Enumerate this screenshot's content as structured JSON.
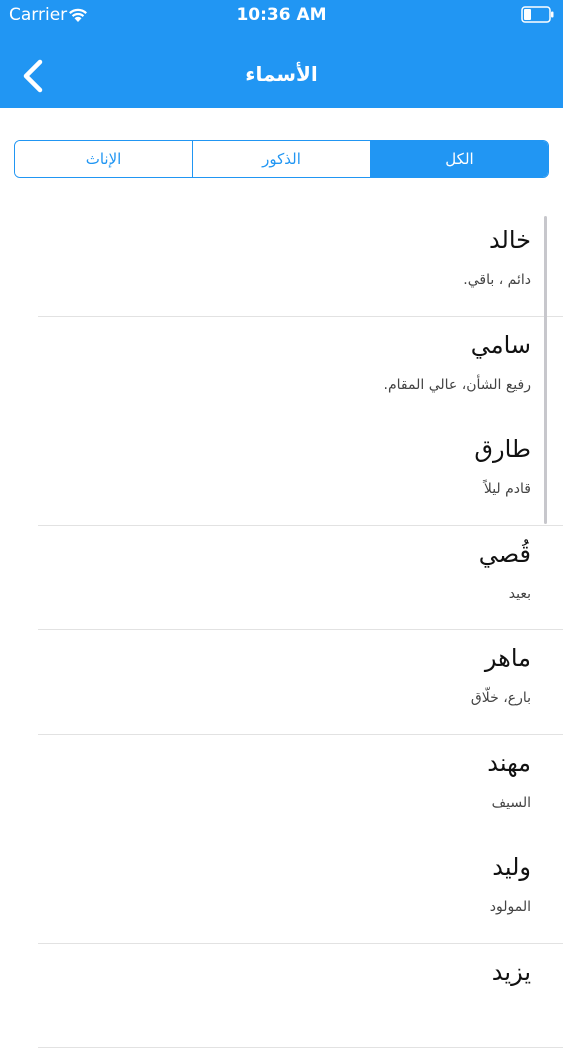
{
  "status_bar": {
    "carrier": "Carrier",
    "time": "10:36 AM"
  },
  "nav": {
    "title": "الأسماء",
    "back_icon": "chevron-left-icon"
  },
  "segments": [
    {
      "label": "الكل",
      "active": true
    },
    {
      "label": "الذكور",
      "active": false
    },
    {
      "label": "الإناث",
      "active": false
    }
  ],
  "names": [
    {
      "name": "خالد",
      "meaning": "دائم ، باقي."
    },
    {
      "name": "سامي",
      "meaning": "رفيع الشأن، عالي المقام."
    },
    {
      "name": "طارق",
      "meaning": "قادم ليلاً"
    },
    {
      "name": "قُصي",
      "meaning": "بعيد"
    },
    {
      "name": "ماهر",
      "meaning": "بارع، خلّاق"
    },
    {
      "name": "مهند",
      "meaning": "السيف"
    },
    {
      "name": "وليد",
      "meaning": "المولود"
    },
    {
      "name": "يزيد",
      "meaning": ""
    }
  ],
  "colors": {
    "accent": "#2196f3",
    "divider": "#e2e2e2"
  }
}
